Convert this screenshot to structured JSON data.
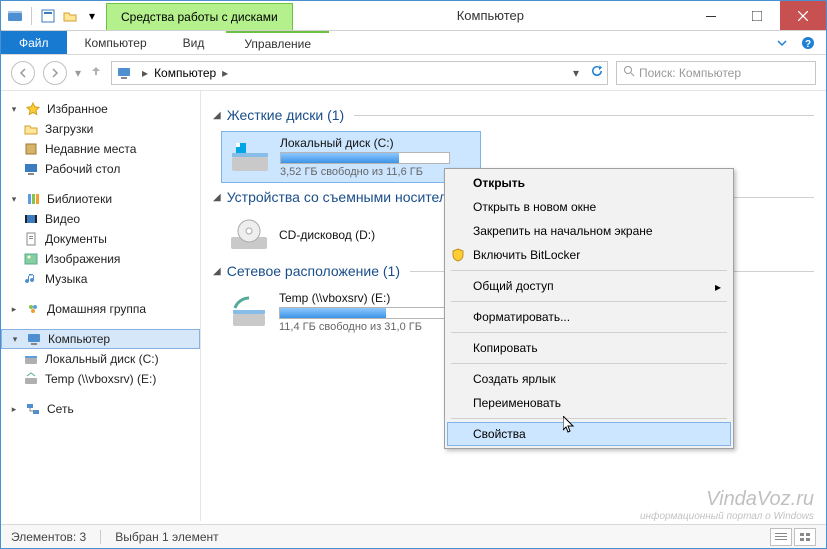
{
  "window": {
    "title": "Компьютер",
    "context_tab": "Средства работы с дисками"
  },
  "ribbon": {
    "file": "Файл",
    "tabs": [
      "Компьютер",
      "Вид"
    ],
    "context_tabs": [
      "Управление"
    ]
  },
  "nav": {
    "breadcrumb": "Компьютер",
    "search_placeholder": "Поиск: Компьютер"
  },
  "navpane": {
    "favorites": {
      "label": "Избранное",
      "items": [
        "Загрузки",
        "Недавние места",
        "Рабочий стол"
      ]
    },
    "libraries": {
      "label": "Библиотеки",
      "items": [
        "Видео",
        "Документы",
        "Изображения",
        "Музыка"
      ]
    },
    "homegroup": {
      "label": "Домашняя группа"
    },
    "computer": {
      "label": "Компьютер",
      "items": [
        "Локальный диск (C:)",
        "Temp (\\\\vboxsrv) (E:)"
      ]
    },
    "network": {
      "label": "Сеть"
    }
  },
  "groups": {
    "hdd": {
      "header": "Жесткие диски (1)",
      "drive": {
        "name": "Локальный диск (C:)",
        "free_text": "3,52 ГБ свободно из 11,6 ГБ",
        "fill_percent": 70
      }
    },
    "removable": {
      "header": "Устройства со съемными носителями",
      "drive": {
        "name": "CD-дисковод (D:)"
      }
    },
    "network": {
      "header": "Сетевое расположение (1)",
      "drive": {
        "name": "Temp (\\\\vboxsrv) (E:)",
        "free_text": "11,4 ГБ свободно из 31,0 ГБ",
        "fill_percent": 63
      }
    }
  },
  "context_menu": {
    "items": [
      {
        "label": "Открыть",
        "bold": true
      },
      {
        "label": "Открыть в новом окне"
      },
      {
        "label": "Закрепить на начальном экране"
      },
      {
        "label": "Включить BitLocker",
        "icon": "shield"
      },
      {
        "sep": true
      },
      {
        "label": "Общий доступ",
        "submenu": true
      },
      {
        "sep": true
      },
      {
        "label": "Форматировать..."
      },
      {
        "sep": true
      },
      {
        "label": "Копировать"
      },
      {
        "sep": true
      },
      {
        "label": "Создать ярлык"
      },
      {
        "label": "Переименовать"
      },
      {
        "sep": true
      },
      {
        "label": "Свойства",
        "hover": true
      }
    ]
  },
  "status": {
    "count": "Элементов: 3",
    "selection": "Выбран 1 элемент"
  },
  "watermark": {
    "big": "VindaVoz.ru",
    "small": "информационный портал о Windows"
  }
}
